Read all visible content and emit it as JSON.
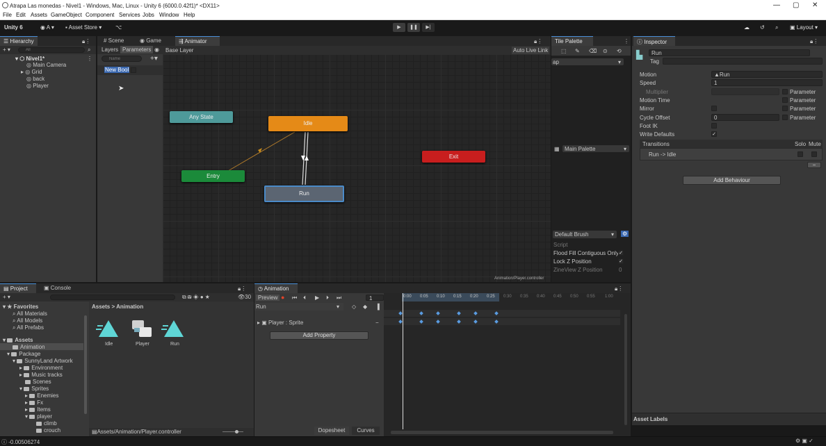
{
  "window": {
    "title": "Atrapa Las monedas - Nivel1 - Windows, Mac, Linux - Unity 6 (6000.0.42f1)* <DX11>"
  },
  "menu": [
    "File",
    "Edit",
    "Assets",
    "GameObject",
    "Component",
    "Services",
    "Jobs",
    "Window",
    "Help"
  ],
  "toolbar": {
    "unity": "Unity 6",
    "account": "A",
    "asset_store": "Asset Store",
    "layout": "Layout"
  },
  "hierarchy": {
    "tab": "Hierarchy",
    "search_placeholder": "All",
    "scene": "Nivel1*",
    "items": [
      "Main Camera",
      "Grid",
      "back",
      "Player"
    ]
  },
  "animator": {
    "tabs": {
      "scene": "Scene",
      "game": "Game",
      "animator": "Animator"
    },
    "layers": "Layers",
    "parameters": "Parameters",
    "base_layer": "Base Layer",
    "auto_live_link": "Auto Live Link",
    "name_placeholder": "Name",
    "param_name": "New Bool",
    "states": {
      "any": "Any State",
      "idle": "Idle",
      "entry": "Entry",
      "run": "Run",
      "exit": "Exit"
    },
    "footer": "Animation/Player.controller"
  },
  "tile_palette": {
    "tab": "Tile Palette",
    "map": "ap",
    "palette": "Main Palette",
    "brush": "Default Brush",
    "script": "Script",
    "flood": "Flood Fill Contiguous Only",
    "lockz": "Lock Z Position",
    "zpos": "ZineView Z Position",
    "zpos_value": "0"
  },
  "inspector": {
    "tab": "Inspector",
    "name": "Run",
    "tag": "Tag",
    "props": {
      "motion": "Motion",
      "motion_value": "Run",
      "speed": "Speed",
      "speed_value": "1",
      "multiplier": "Multiplier",
      "motion_time": "Motion Time",
      "mirror": "Mirror",
      "cycle_offset": "Cycle Offset",
      "cycle_value": "0",
      "foot_ik": "Foot IK",
      "write_defaults": "Write Defaults",
      "parameter": "Parameter"
    },
    "transitions": "Transitions",
    "solo": "Solo",
    "mute": "Mute",
    "transition_item": "Run -> Idle",
    "add_behaviour": "Add Behaviour",
    "asset_labels": "Asset Labels"
  },
  "project": {
    "tabs": {
      "project": "Project",
      "console": "Console"
    },
    "count": "30",
    "favorites": "Favorites",
    "fav_items": [
      "All Materials",
      "All Models",
      "All Prefabs"
    ],
    "tree": {
      "assets": "Assets",
      "animation": "Animation",
      "package": "Package",
      "sunnyland": "SunnyLand Artwork",
      "environment": "Environment",
      "music": "Music tracks",
      "scenes": "Scenes",
      "sprites": "Sprites",
      "enemies": "Enemies",
      "fx": "Fx",
      "items": "Items",
      "player": "player",
      "climb": "climb",
      "crouch": "crouch"
    },
    "breadcrumb": {
      "assets": "Assets",
      "sep": ">",
      "animation": "Animation"
    },
    "files": [
      "Idle",
      "Player",
      "Run"
    ],
    "path": "Assets/Animation/Player.controller"
  },
  "animation": {
    "tab": "Animation",
    "preview": "Preview",
    "frame": "1",
    "clip": "Run",
    "property": "Player : Sprite",
    "add_property": "Add Property",
    "ticks": [
      "0:00",
      "0:05",
      "0:10",
      "0:15",
      "0:20",
      "0:25",
      "0:30",
      "0:35",
      "0:40",
      "0:45",
      "0:50",
      "0:55",
      "1:00"
    ],
    "dopesheet": "Dopesheet",
    "curves": "Curves"
  },
  "status": {
    "value": "-0.00506274"
  },
  "colors": {
    "any": "#4e9a9a",
    "idle": "#e58a17",
    "entry": "#1b8a3a",
    "run": "#5b6572",
    "exit": "#c81e1e",
    "accent": "#4a90d9"
  }
}
